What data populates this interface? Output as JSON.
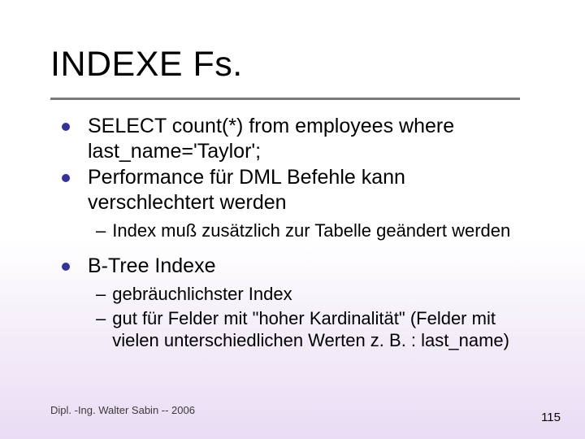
{
  "title": "INDEXE Fs.",
  "bullets": {
    "b1": "SELECT count(*) from employees where last_name='Taylor';",
    "b2": "Performance für DML Befehle kann verschlechtert werden",
    "b2_sub1": "Index muß zusätzlich zur Tabelle geändert werden",
    "b3": "B-Tree Indexe",
    "b3_sub1": "gebräuchlichster Index",
    "b3_sub2": "gut für Felder mit \"hoher Kardinalität\" (Felder mit vielen unterschiedlichen Werten z. B. : last_name)"
  },
  "footer_left": "Dipl. -Ing. Walter Sabin  -- 2006",
  "footer_right": "115"
}
